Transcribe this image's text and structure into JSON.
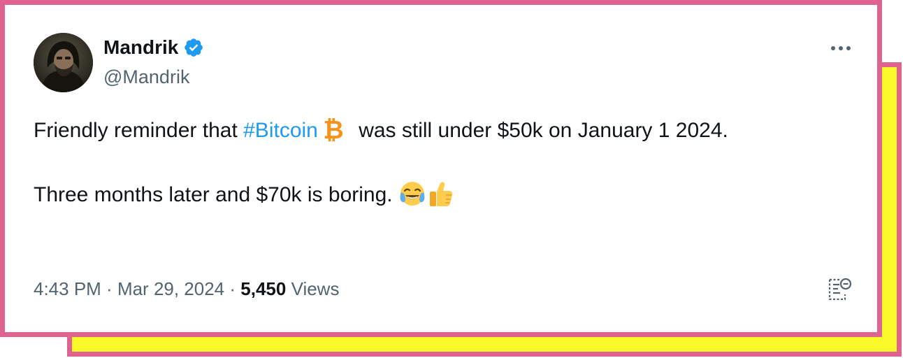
{
  "author": {
    "display_name": "Mandrik",
    "handle": "@Mandrik",
    "verified": true
  },
  "tweet": {
    "line1_pre": "Friendly reminder that ",
    "hashtag": "#Bitcoin",
    "line1_post": " was still under $50k on January 1 2024.",
    "line2": "Three months later and $70k is boring."
  },
  "meta": {
    "time": "4:43 PM",
    "separator1": " · ",
    "date": "Mar 29, 2024",
    "separator2": " · ",
    "views_count": "5,450",
    "views_label": " Views"
  },
  "icons": {
    "more": "more-horizontal-icon",
    "verified": "verified-badge-icon",
    "bitcoin": "bitcoin-icon",
    "emoji1": "tears-of-joy-emoji",
    "emoji2": "thumbs-up-emoji",
    "notes": "community-notes-icon"
  },
  "colors": {
    "border": "#e0628f",
    "shadow_fill": "#fbf92a",
    "link": "#1d9bf0",
    "muted": "#536471",
    "text": "#0f1419",
    "bitcoin": "#f7931a"
  }
}
